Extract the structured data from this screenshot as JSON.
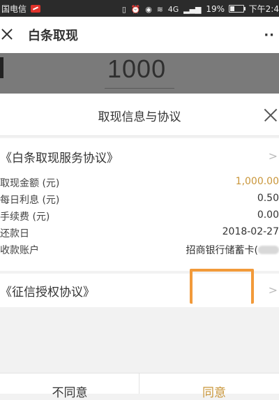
{
  "status_bar": {
    "carrier": "国电信",
    "signal_label": "4G",
    "battery_percent": "19%",
    "time": "下午2:4",
    "colors": {
      "background": "#2b2b2b",
      "carrier_badge": "#e0322b"
    }
  },
  "header": {
    "title": "白条取现",
    "close_icon": "close-icon",
    "more_icon": "more-dots-icon",
    "more_glyph": "··"
  },
  "amount": {
    "value": "1000"
  },
  "sheet": {
    "title": "取现信息与协议",
    "close_icon": "close-icon"
  },
  "service_agreement": {
    "title": "《白条取现服务协议》",
    "chevron": ">",
    "rows": [
      {
        "label": "取现金额 (元)",
        "value": "1,000.00"
      },
      {
        "label": "每日利息 (元)",
        "value": "0.50"
      },
      {
        "label": "手续费 (元)",
        "value": "0.00"
      },
      {
        "label": "还款日",
        "value": "2018-02-27"
      },
      {
        "label": "收款账户",
        "value": "招商银行储蓄卡("
      }
    ]
  },
  "credit_agreement": {
    "title": "《征信授权协议》",
    "chevron": ">"
  },
  "buttons": {
    "disagree": "不同意",
    "agree": "同意"
  },
  "colors": {
    "accent": "#c9963a",
    "highlight": "#f29a3a",
    "dim_overlay": "#7a7a7a"
  }
}
